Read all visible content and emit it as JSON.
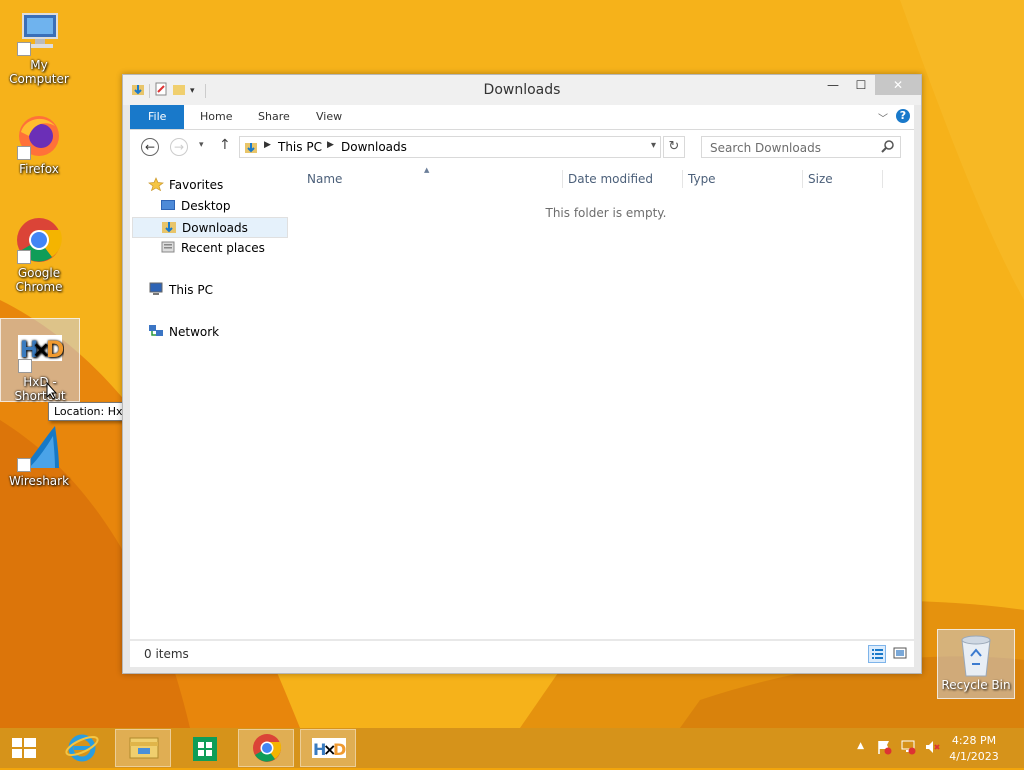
{
  "desktop": {
    "icons": [
      {
        "label": "My Computer"
      },
      {
        "label": "Firefox"
      },
      {
        "label": "Google Chrome"
      },
      {
        "label": "HxD - Shortcut"
      },
      {
        "label": "Wireshark"
      }
    ],
    "tooltip": "Location: HxD (C:\\Program Files\\HxD)",
    "recycle_bin": "Recycle Bin"
  },
  "window": {
    "title": "Downloads",
    "controls": {
      "minimize": "—",
      "maximize": "☐",
      "close": "✕"
    },
    "ribbon_tabs": [
      "File",
      "Home",
      "Share",
      "View"
    ],
    "help": "?",
    "breadcrumb": [
      "This PC",
      "Downloads"
    ],
    "search_placeholder": "Search Downloads",
    "nav": {
      "favorites": "Favorites",
      "desktop": "Desktop",
      "downloads": "Downloads",
      "recent": "Recent places",
      "this_pc": "This PC",
      "network": "Network"
    },
    "columns": [
      "Name",
      "Date modified",
      "Type",
      "Size"
    ],
    "empty_message": "This folder is empty.",
    "status": "0 items"
  },
  "taskbar": {
    "time": "4:28 PM",
    "date": "4/1/2023"
  },
  "colors": {
    "wallpaper": "#f2a50c",
    "taskbar": "#d6931a",
    "accent": "#1979ca"
  }
}
